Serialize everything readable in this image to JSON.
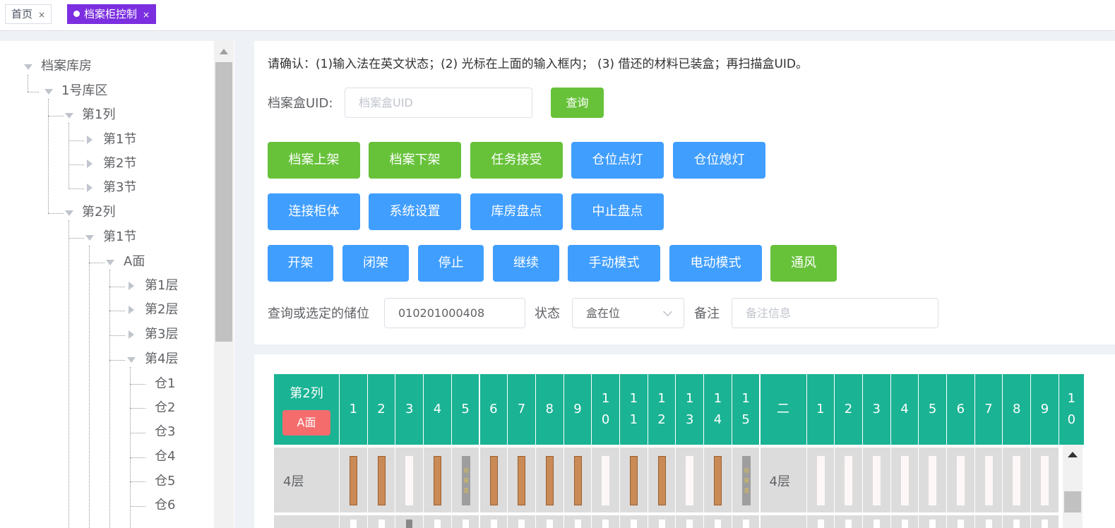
{
  "tabs": [
    {
      "label": "首页",
      "close": "×"
    },
    {
      "label": "档案柜控制",
      "close": "×"
    }
  ],
  "tree": [
    {
      "label": "档案库房",
      "expanded": true
    },
    {
      "label": "1号库区",
      "expanded": true
    },
    {
      "label": "第1列",
      "expanded": true
    },
    {
      "label": "第1节",
      "expanded": false
    },
    {
      "label": "第2节",
      "expanded": false
    },
    {
      "label": "第3节",
      "expanded": false
    },
    {
      "label": "第2列",
      "expanded": true
    },
    {
      "label": "第1节",
      "expanded": true
    },
    {
      "label": "A面",
      "expanded": true
    },
    {
      "label": "第1层",
      "expanded": false
    },
    {
      "label": "第2层",
      "expanded": false
    },
    {
      "label": "第3层",
      "expanded": false
    },
    {
      "label": "第4层",
      "expanded": true
    },
    {
      "label": "仓1"
    },
    {
      "label": "仓2"
    },
    {
      "label": "仓3"
    },
    {
      "label": "仓4"
    },
    {
      "label": "仓5"
    },
    {
      "label": "仓6"
    }
  ],
  "control": {
    "notice": "请确认：(1)输入法在英文状态；(2) 光标在上面的输入框内； (3) 借还的材料已装盒；再扫描盒UID。",
    "uid_label": "档案盒UID:",
    "uid_placeholder": "档案盒UID",
    "query_button": "查询",
    "buttons_row1": [
      "档案上架",
      "档案下架",
      "任务接受",
      "仓位点灯",
      "仓位熄灯"
    ],
    "buttons_row2": [
      "连接柜体",
      "系统设置",
      "库房盘点",
      "中止盘点"
    ],
    "buttons_row3": [
      "开架",
      "闭架",
      "停止",
      "继续",
      "手动模式",
      "电动模式",
      "通风"
    ],
    "location_label": "查询或选定的储位",
    "location_value": "010201000408",
    "status_label": "状态",
    "status_value": "盒在位",
    "remark_label": "备注",
    "remark_placeholder": "备注信息"
  },
  "grid": {
    "column_label": "第2列",
    "face_label": "A面",
    "section1_cols": [
      "1",
      "2",
      "3",
      "4",
      "5",
      "6",
      "7",
      "8",
      "9",
      "1\n0",
      "1\n1",
      "1\n2",
      "1\n3",
      "1\n4",
      "1\n5"
    ],
    "section_divider": "二",
    "section2_cols": [
      "1",
      "2",
      "3",
      "4",
      "5",
      "6",
      "7",
      "8",
      "9",
      "1\n0"
    ],
    "row_label": "4层",
    "row_label_2": "4层",
    "section1_slots": [
      "brown",
      "brown",
      "white",
      "brown",
      "gray",
      "brown",
      "brown",
      "brown",
      "brown",
      "white",
      "brown",
      "brown",
      "white",
      "brown",
      "gray"
    ],
    "section2_slots": [
      "white",
      "white",
      "white",
      "white",
      "white",
      "white",
      "white",
      "white",
      "white"
    ],
    "gray_box_glyphs": "档\n案\n盒"
  },
  "colors": {
    "accent_tab": "#7b2fe0",
    "green_button": "#67c23a",
    "blue_button": "#409eff",
    "grid_header": "#1ab394",
    "face_badge": "#f56c6c",
    "box_brown": "#c98a55"
  }
}
